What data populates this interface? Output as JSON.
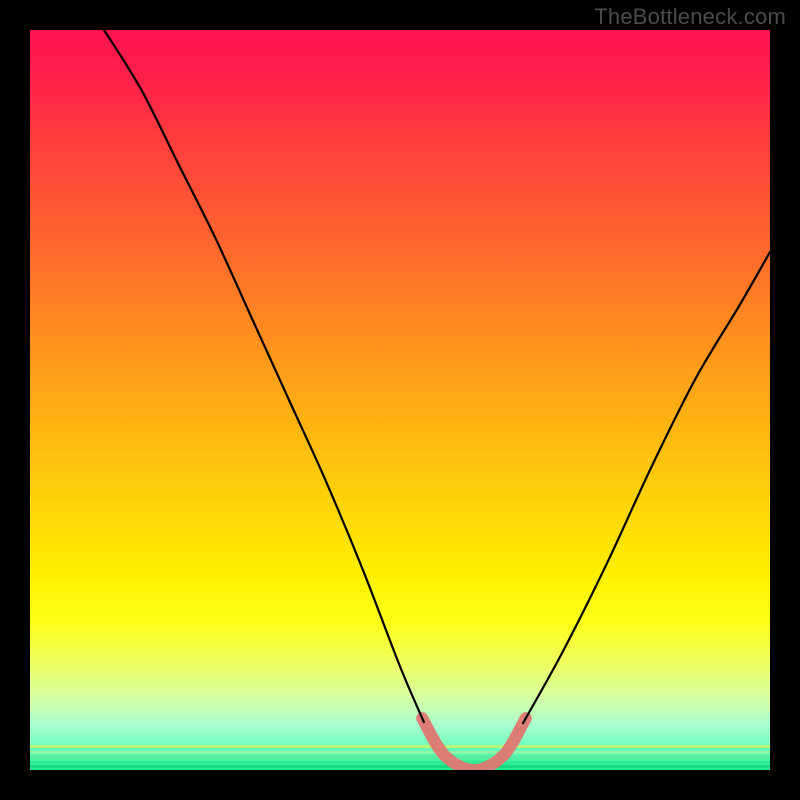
{
  "watermark": "TheBottleneck.com",
  "colors": {
    "frame": "#000000",
    "watermark_text": "#4c4c4c",
    "curve": "#000000",
    "trough": "#e07771",
    "gradient_stops": [
      "#ff1450",
      "#ff1e4a",
      "#ff3a3f",
      "#ff5a33",
      "#ff7a26",
      "#ff9a1a",
      "#ffb910",
      "#ffd708",
      "#fff000",
      "#fdff17",
      "#f0ff58",
      "#d7ffa0",
      "#a8ffd0",
      "#6bffb8",
      "#1cf082"
    ]
  },
  "chart_data": {
    "type": "line",
    "title": "",
    "xlabel": "",
    "ylabel": "",
    "xlim": [
      0,
      100
    ],
    "ylim": [
      0,
      100
    ],
    "grid": false,
    "legend": false,
    "description": "V-shaped bottleneck curve: y≈0 is optimal (green), y≈100 is worst (red). Minimum plateau highlighted in salmon near x≈55–65.",
    "series": [
      {
        "name": "left-branch",
        "x": [
          10,
          15,
          20,
          25,
          30,
          35,
          40,
          45,
          50,
          53
        ],
        "y": [
          100,
          92,
          82,
          72,
          61,
          50,
          39,
          27,
          14,
          7
        ]
      },
      {
        "name": "trough",
        "x": [
          53,
          56,
          60,
          64,
          67
        ],
        "y": [
          7,
          2,
          0,
          2,
          7
        ]
      },
      {
        "name": "right-branch",
        "x": [
          67,
          72,
          78,
          84,
          90,
          96,
          100
        ],
        "y": [
          7,
          16,
          28,
          41,
          53,
          63,
          70
        ]
      }
    ]
  }
}
